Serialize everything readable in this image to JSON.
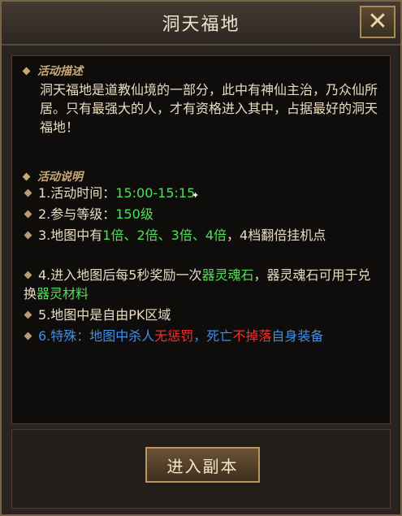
{
  "window": {
    "title": "洞天福地",
    "close_label": "✕"
  },
  "description": {
    "header": "活动描述",
    "text": "洞天福地是道教仙境的一部分，此中有神仙主治，乃众仙所居。只有最强大的人，才有资格进入其中，占据最好的洞天福地！"
  },
  "rules": {
    "header": "活动说明",
    "item1_prefix": "1.活动时间：",
    "item1_value": "15:00-15:15",
    "item2_prefix": "2.参与等级：",
    "item2_value": "150级",
    "item3_prefix": "3.地图中有",
    "item3_values": "1倍、2倍、3倍、4倍",
    "item3_suffix": "，4档翻倍挂机点",
    "item4_prefix": "4.进入地图后每5秒奖励一次",
    "item4_reward1": "器灵魂石",
    "item4_middle": "，器灵魂石可用于兑换",
    "item4_reward2": "器灵材料",
    "item5": "5.地图中是自由PK区域",
    "item6_prefix": "6.特殊：地图中杀人",
    "item6_red1": "无惩罚",
    "item6_middle": "，死亡",
    "item6_red2": "不掉落",
    "item6_suffix": "自身装备"
  },
  "buttons": {
    "enter_label": "进入副本"
  }
}
